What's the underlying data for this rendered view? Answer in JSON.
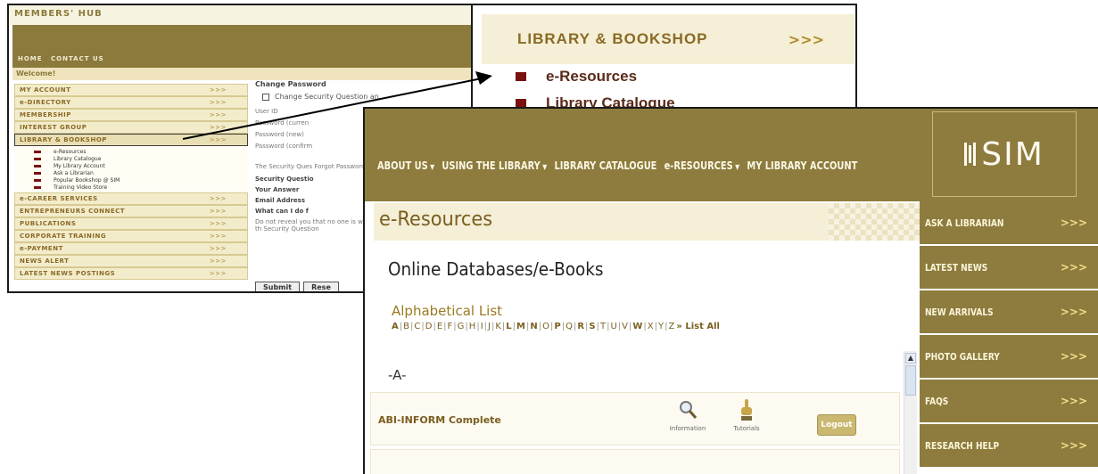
{
  "hub": {
    "title": "MEMBERS' HUB",
    "nav": [
      "HOME",
      "CONTACT US"
    ],
    "welcome": "Welcome!",
    "menu": [
      {
        "label": "MY ACCOUNT",
        "arrow": ">>>"
      },
      {
        "label": "e-DIRECTORY",
        "arrow": ">>>"
      },
      {
        "label": "MEMBERSHIP",
        "arrow": ">>>"
      },
      {
        "label": "INTEREST GROUP",
        "arrow": ">>>"
      },
      {
        "label": "LIBRARY & BOOKSHOP",
        "arrow": ">>>"
      },
      {
        "label": "e-CAREER SERVICES",
        "arrow": ">>>"
      },
      {
        "label": "ENTREPRENEURS CONNECT",
        "arrow": ">>>"
      },
      {
        "label": "PUBLICATIONS",
        "arrow": ">>>"
      },
      {
        "label": "CORPORATE TRAINING",
        "arrow": ">>>"
      },
      {
        "label": "e-PAYMENT",
        "arrow": ">>>"
      },
      {
        "label": "NEWS ALERT",
        "arrow": ">>>"
      },
      {
        "label": "LATEST NEWS POSTINGS",
        "arrow": ">>>"
      }
    ],
    "submenu": [
      "e-Resources",
      "Library Catalogue",
      "My Library Account",
      "Ask a Librarian",
      "Popular Bookshop @ SIM",
      "Training Video Store"
    ],
    "form": {
      "heading": "Change Password",
      "checkbox_label": "Change Security Question an",
      "rows": [
        "User ID",
        "Password (curren",
        "Password (new)",
        "Password (confirm"
      ],
      "para1": "The Security Ques Forgot Password password, the can",
      "security_question": "Security Questio",
      "your_answer": "Your Answer",
      "email": "Email Address",
      "what_heading": "What can I do f",
      "para2": "Do not reveal you that no one is wat you need to keep using anything th Security Question",
      "submit": "Submit",
      "reset": "Rese"
    }
  },
  "zoom": {
    "title": "LIBRARY & BOOKSHOP",
    "arrow": ">>>",
    "items": [
      "e-Resources",
      "Library Catalogue"
    ]
  },
  "sim": {
    "nav": [
      {
        "label": "ABOUT US",
        "caret": "▼"
      },
      {
        "label": "USING THE LIBRARY",
        "caret": "▼"
      },
      {
        "label": "LIBRARY CATALOGUE",
        "caret": ""
      },
      {
        "label": "e-RESOURCES",
        "caret": "▼"
      },
      {
        "label": "MY LIBRARY ACCOUNT",
        "caret": ""
      }
    ],
    "logo_text": "SIM",
    "page_title": "e-Resources",
    "section_title": "Online Databases/e-Books",
    "alpha_title": "Alphabetical List",
    "letters": [
      "A",
      "B",
      "C",
      "D",
      "E",
      "F",
      "G",
      "H",
      "I",
      "J",
      "K",
      "L",
      "M",
      "N",
      "O",
      "P",
      "Q",
      "R",
      "S",
      "T",
      "U",
      "V",
      "W",
      "X",
      "Y",
      "Z"
    ],
    "bold_letters": [
      "A",
      "L",
      "M",
      "N",
      "P",
      "R",
      "S",
      "W"
    ],
    "list_all": "» List All",
    "current_letter": "-A-",
    "database": {
      "name": "ABI-INFORM Complete",
      "info": "Information",
      "tutorials": "Tutorials",
      "logout": "Logout"
    },
    "sidebar": [
      {
        "label": "ASK A LIBRARIAN",
        "arrow": ">>>"
      },
      {
        "label": "LATEST NEWS",
        "arrow": ">>>"
      },
      {
        "label": "NEW ARRIVALS",
        "arrow": ">>>"
      },
      {
        "label": "PHOTO GALLERY",
        "arrow": ">>>"
      },
      {
        "label": "FAQS",
        "arrow": ">>>"
      },
      {
        "label": "RESEARCH HELP",
        "arrow": ">>>"
      }
    ]
  }
}
